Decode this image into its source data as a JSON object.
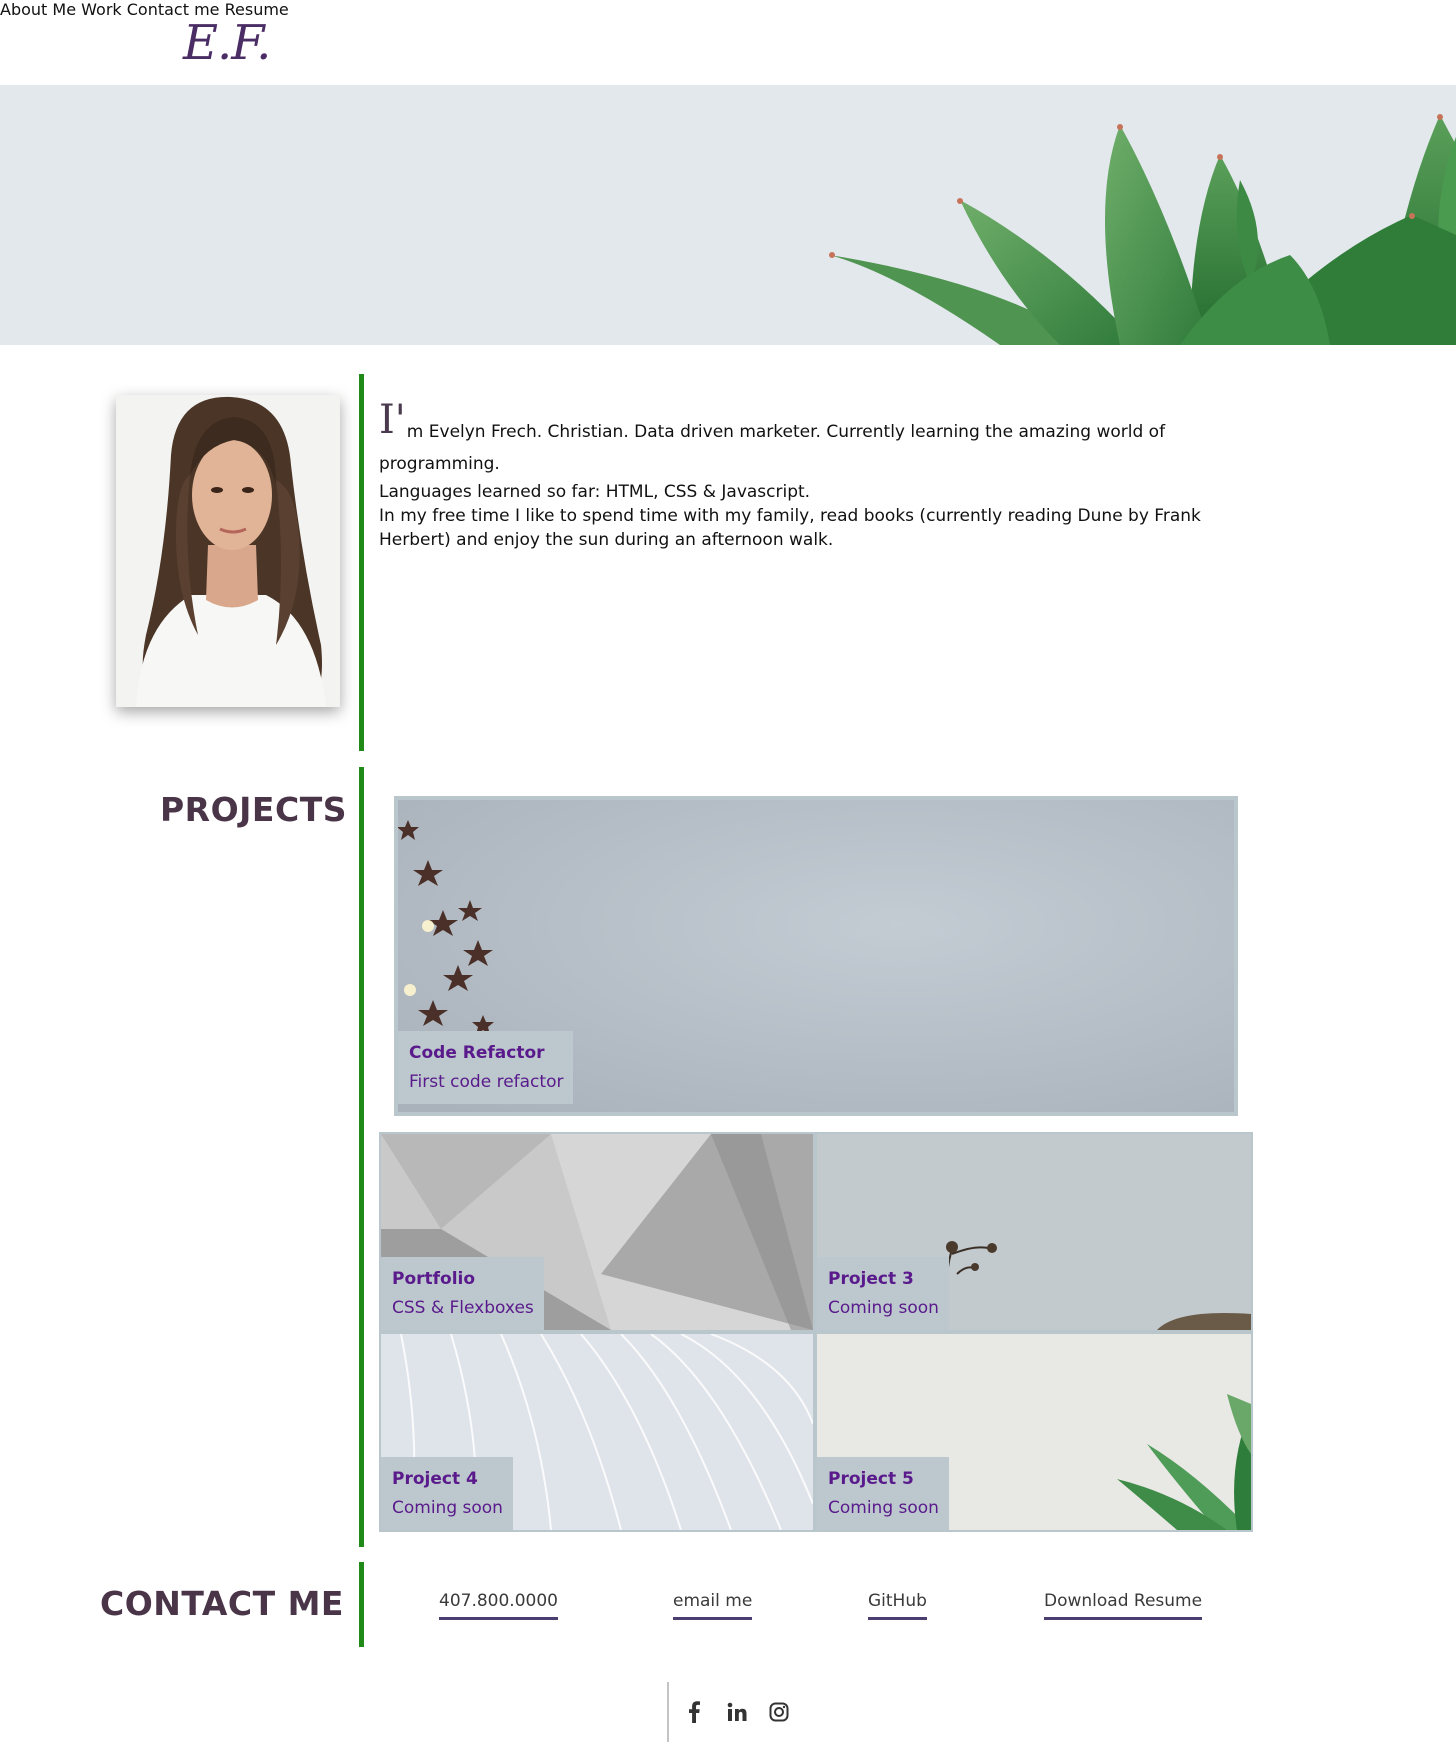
{
  "header": {
    "logo": "E.F.",
    "nav": [
      "About Me",
      "Work",
      "Contact me",
      "Resume"
    ]
  },
  "about": {
    "dropcap": "I'",
    "line1": "m Evelyn Frech. Christian. Data driven marketer. Currently learning the amazing world of programming.",
    "line2": "Languages learned so far: HTML, CSS & Javascript.",
    "line3": "In my free time I like to spend time with my family, read books (currently reading Dune by Frank Herbert) and enjoy the sun during an afternoon walk."
  },
  "projects": {
    "title": "PROJECTS",
    "items": [
      {
        "title": "Code Refactor",
        "subtitle": "First code refactor"
      },
      {
        "title": "Portfolio",
        "subtitle": "CSS & Flexboxes"
      },
      {
        "title": "Project 3",
        "subtitle": "Coming soon"
      },
      {
        "title": "Project 4",
        "subtitle": "Coming soon"
      },
      {
        "title": "Project 5",
        "subtitle": "Coming soon"
      }
    ]
  },
  "contact": {
    "title": "CONTACT ME",
    "links": [
      "407.800.0000",
      "email me",
      "GitHub",
      "Download Resume"
    ]
  },
  "footer": {
    "social_icons": [
      "facebook-icon",
      "linkedin-icon",
      "instagram-icon"
    ]
  },
  "colors": {
    "accent_line": "#1f8a17",
    "brand_purple": "#5a1a8c",
    "caption_bg": "#bcc8cd",
    "heading": "#4a3548"
  }
}
